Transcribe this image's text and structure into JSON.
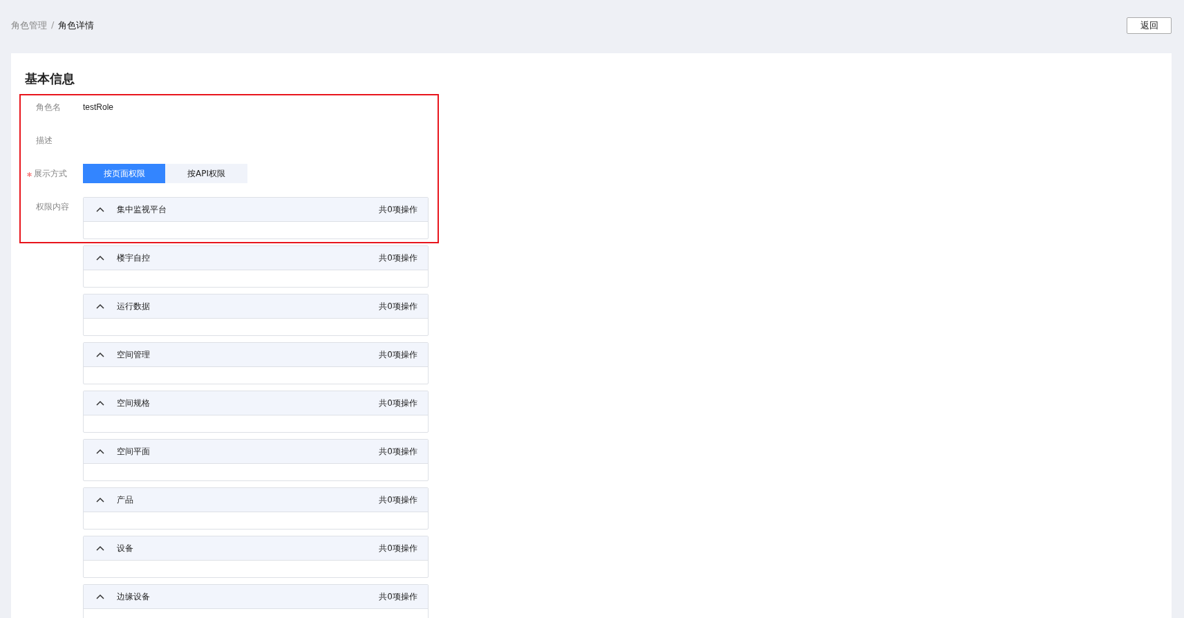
{
  "breadcrumb": [
    {
      "label": "角色管理",
      "current": false
    },
    {
      "label": "角色详情",
      "current": true
    }
  ],
  "breadcrumb_separator": "/",
  "back_button": "返回",
  "section_title": "基本信息",
  "form": {
    "role_name": {
      "label": "角色名",
      "value": "testRole"
    },
    "description": {
      "label": "描述"
    },
    "display_mode": {
      "label": "展示方式",
      "required": true,
      "options": [
        {
          "label": "按页面权限",
          "selected": true
        },
        {
          "label": "按API权限",
          "selected": false
        }
      ]
    },
    "permissions": {
      "label": "权限内容",
      "groups": [
        {
          "title": "集中监视平台",
          "count": "共0项操作",
          "expanded": true
        },
        {
          "title": "楼宇自控",
          "count": "共0项操作",
          "expanded": true
        },
        {
          "title": "运行数据",
          "count": "共0项操作",
          "expanded": true
        },
        {
          "title": "空间管理",
          "count": "共0项操作",
          "expanded": true
        },
        {
          "title": "空间规格",
          "count": "共0项操作",
          "expanded": true
        },
        {
          "title": "空间平面",
          "count": "共0项操作",
          "expanded": true
        },
        {
          "title": "产品",
          "count": "共0项操作",
          "expanded": true
        },
        {
          "title": "设备",
          "count": "共0项操作",
          "expanded": true
        },
        {
          "title": "边缘设备",
          "count": "共0项操作",
          "expanded": true
        }
      ]
    }
  },
  "highlight": {
    "shown": true
  }
}
